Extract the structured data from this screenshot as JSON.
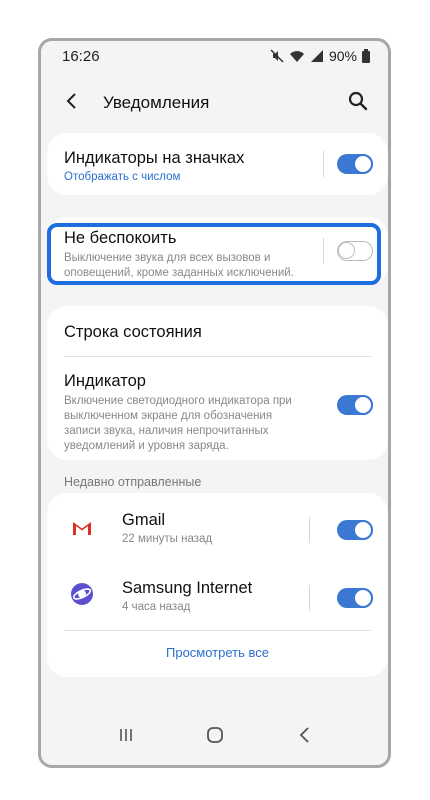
{
  "status_bar": {
    "time": "16:26",
    "battery": "90%",
    "icons": [
      "mute-icon",
      "wifi-icon",
      "signal-icon",
      "battery-icon"
    ]
  },
  "app_bar": {
    "title": "Уведомления",
    "back_icon": "chevron-left-icon",
    "search_icon": "search-icon"
  },
  "settings": {
    "badges": {
      "title": "Индикаторы на значках",
      "subtitle": "Отображать с числом",
      "enabled": true
    },
    "dnd": {
      "title": "Не беспокоить",
      "subtitle_line1": "Выключение звука для всех вызовов и",
      "subtitle_line2": "оповещений, кроме заданных исключений.",
      "enabled": false
    },
    "status_bar_row": {
      "title": "Строка состояния"
    },
    "indicator": {
      "title": "Индикатор",
      "subtitle_line1": "Включение светодиодного индикатора при",
      "subtitle_line2": "выключенном экране для обозначения",
      "subtitle_line3": "записи звука, наличия непрочитанных",
      "subtitle_line4": "уведомлений и уровня заряда.",
      "enabled": true
    }
  },
  "recent": {
    "section_label": "Недавно отправленные",
    "apps": [
      {
        "name": "Gmail",
        "time": "22 минуты назад",
        "icon": "gmail-icon",
        "enabled": true
      },
      {
        "name": "Samsung Internet",
        "time": "4 часа назад",
        "icon": "samsung-internet-icon",
        "enabled": true
      }
    ],
    "see_all": "Просмотреть все"
  },
  "colors": {
    "accent": "#3a78d4",
    "highlight": "#1d6fe0",
    "background": "#f4f4f4"
  },
  "nav_bar": {
    "icons": [
      "recents-icon",
      "home-icon",
      "back-icon"
    ]
  }
}
